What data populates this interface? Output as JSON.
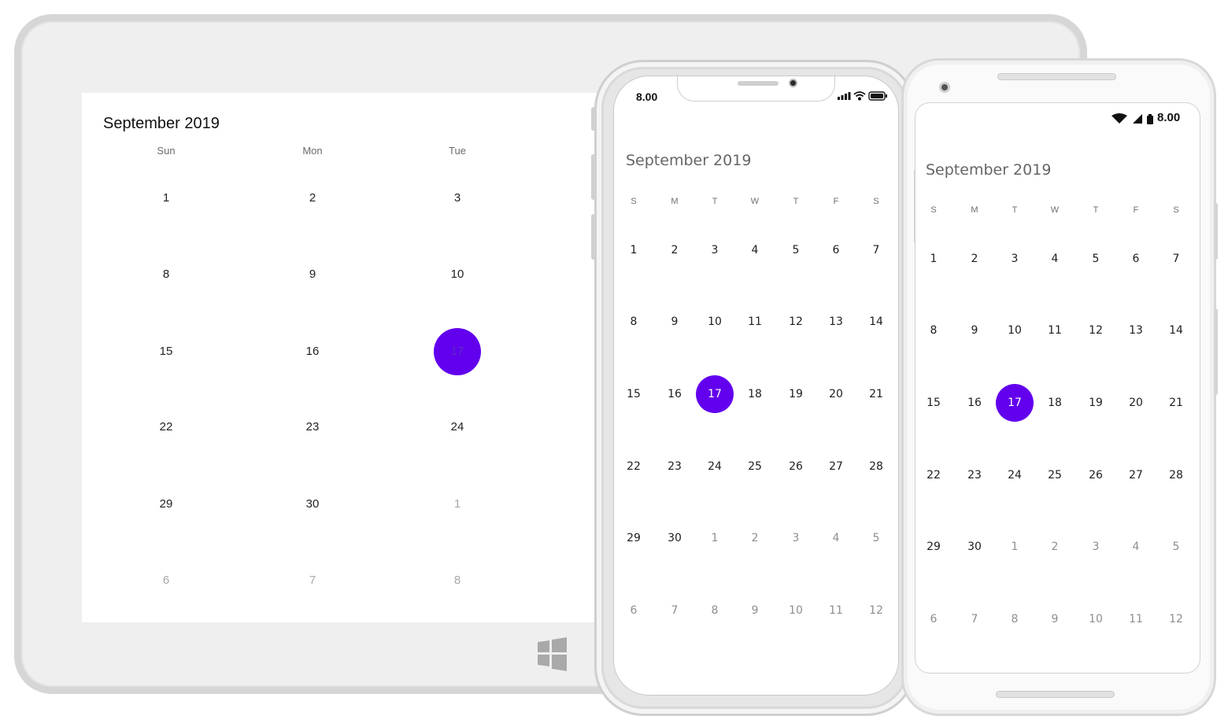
{
  "colors": {
    "accent": "#6200ee",
    "frame": "#efefef",
    "muted": "#a8a8a8"
  },
  "tablet": {
    "title": "September 2019",
    "weekdays": [
      "Sun",
      "Mon",
      "Tue"
    ],
    "rows": [
      [
        "1",
        "2",
        "3"
      ],
      [
        "8",
        "9",
        "10"
      ],
      [
        "15",
        "16",
        "17"
      ],
      [
        "22",
        "23",
        "24"
      ],
      [
        "29",
        "30",
        "1"
      ],
      [
        "6",
        "7",
        "8"
      ]
    ],
    "muted": [
      [
        4,
        2
      ],
      [
        5,
        0
      ],
      [
        5,
        1
      ],
      [
        5,
        2
      ]
    ],
    "selected": [
      2,
      2
    ],
    "logo_icon": "windows-logo-icon"
  },
  "iphone": {
    "time": "8.00",
    "status_icons": [
      "signal-icon",
      "wifi-icon",
      "battery-icon"
    ],
    "title": "September 2019",
    "weekdays": [
      "S",
      "M",
      "T",
      "W",
      "T",
      "F",
      "S"
    ],
    "rows": [
      [
        "1",
        "2",
        "3",
        "4",
        "5",
        "6",
        "7"
      ],
      [
        "8",
        "9",
        "10",
        "11",
        "12",
        "13",
        "14"
      ],
      [
        "15",
        "16",
        "17",
        "18",
        "19",
        "20",
        "21"
      ],
      [
        "22",
        "23",
        "24",
        "25",
        "26",
        "27",
        "28"
      ],
      [
        "29",
        "30",
        "1",
        "2",
        "3",
        "4",
        "5"
      ],
      [
        "6",
        "7",
        "8",
        "9",
        "10",
        "11",
        "12"
      ]
    ],
    "muted_from": [
      4,
      2
    ],
    "selected": [
      2,
      2
    ]
  },
  "android": {
    "time": "8.00",
    "status_icons": [
      "wifi-icon",
      "signal-icon",
      "battery-icon"
    ],
    "title": "September 2019",
    "weekdays": [
      "S",
      "M",
      "T",
      "W",
      "T",
      "F",
      "S"
    ],
    "rows": [
      [
        "1",
        "2",
        "3",
        "4",
        "5",
        "6",
        "7"
      ],
      [
        "8",
        "9",
        "10",
        "11",
        "12",
        "13",
        "14"
      ],
      [
        "15",
        "16",
        "17",
        "18",
        "19",
        "20",
        "21"
      ],
      [
        "22",
        "23",
        "24",
        "25",
        "26",
        "27",
        "28"
      ],
      [
        "29",
        "30",
        "1",
        "2",
        "3",
        "4",
        "5"
      ],
      [
        "6",
        "7",
        "8",
        "9",
        "10",
        "11",
        "12"
      ]
    ],
    "muted_from": [
      4,
      2
    ],
    "selected": [
      2,
      2
    ]
  }
}
